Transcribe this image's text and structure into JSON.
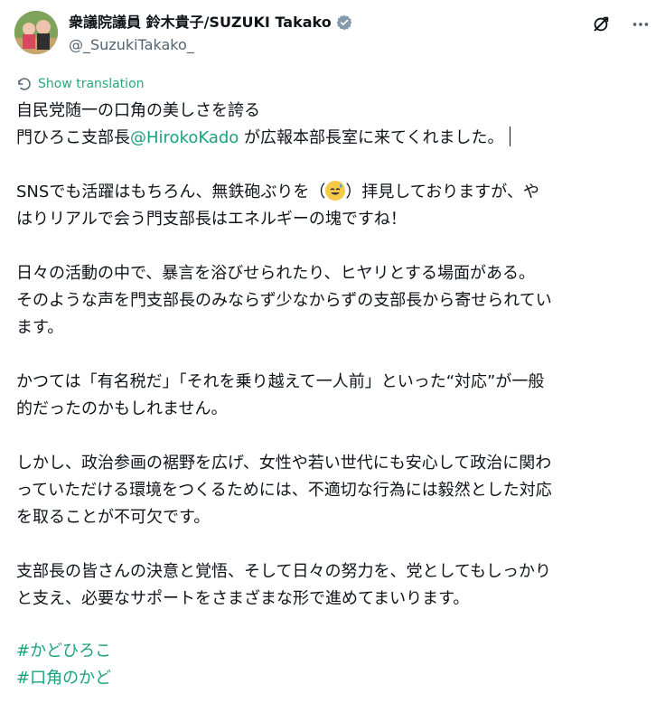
{
  "author": {
    "display_name": "衆議院議員 鈴木貴子/SUZUKI Takako",
    "handle": "@_SuzukiTakako_"
  },
  "actions": {
    "translate_label": "Show translation"
  },
  "tweet": {
    "p1": "自民党随一の口角の美しさを誇る",
    "p2_prefix": "門ひろこ支部長",
    "p2_mention": "@HirokoKado",
    "p2_suffix": " が広報本部長室に来てくれました。",
    "p3_a": "SNSでも活躍はもちろん、無鉄砲ぶりを（",
    "p3_b": "）拝見しておりますが、や",
    "p3_c": "はりリアルで会う門支部長はエネルギーの塊ですね！",
    "p4": "日々の活動の中で、暴言を浴びせられたり、ヒヤリとする場面がある。",
    "p5": "そのような声を門支部長のみならず少なからずの支部長から寄せられてい",
    "p6": "ます。",
    "p7": "かつては「有名税だ」「それを乗り越えて一人前」といった“対応”が一般",
    "p8": "的だったのかもしれません。",
    "p9": "しかし、政治参画の裾野を広げ、女性や若い世代にも安心して政治に関わ",
    "p10": "っていただける環境をつくるためには、不適切な行為には毅然とした対応",
    "p11": "を取ることが不可欠です。",
    "p12": "支部長の皆さんの決意と覚悟、そして日々の努力を、党としてもしっかり",
    "p13": "と支え、必要なサポートをさまざまな形で進めてまいります。"
  },
  "hashtags": [
    "#かどひろこ",
    "#口角のかど"
  ],
  "icons": [
    "verified-badge-icon",
    "grok-icon",
    "more-icon",
    "translate-icon",
    "sweat-smile-emoji-icon"
  ],
  "colors": {
    "accent_link": "#1aa37a",
    "text_primary": "#0f1419",
    "text_secondary": "#536471"
  }
}
